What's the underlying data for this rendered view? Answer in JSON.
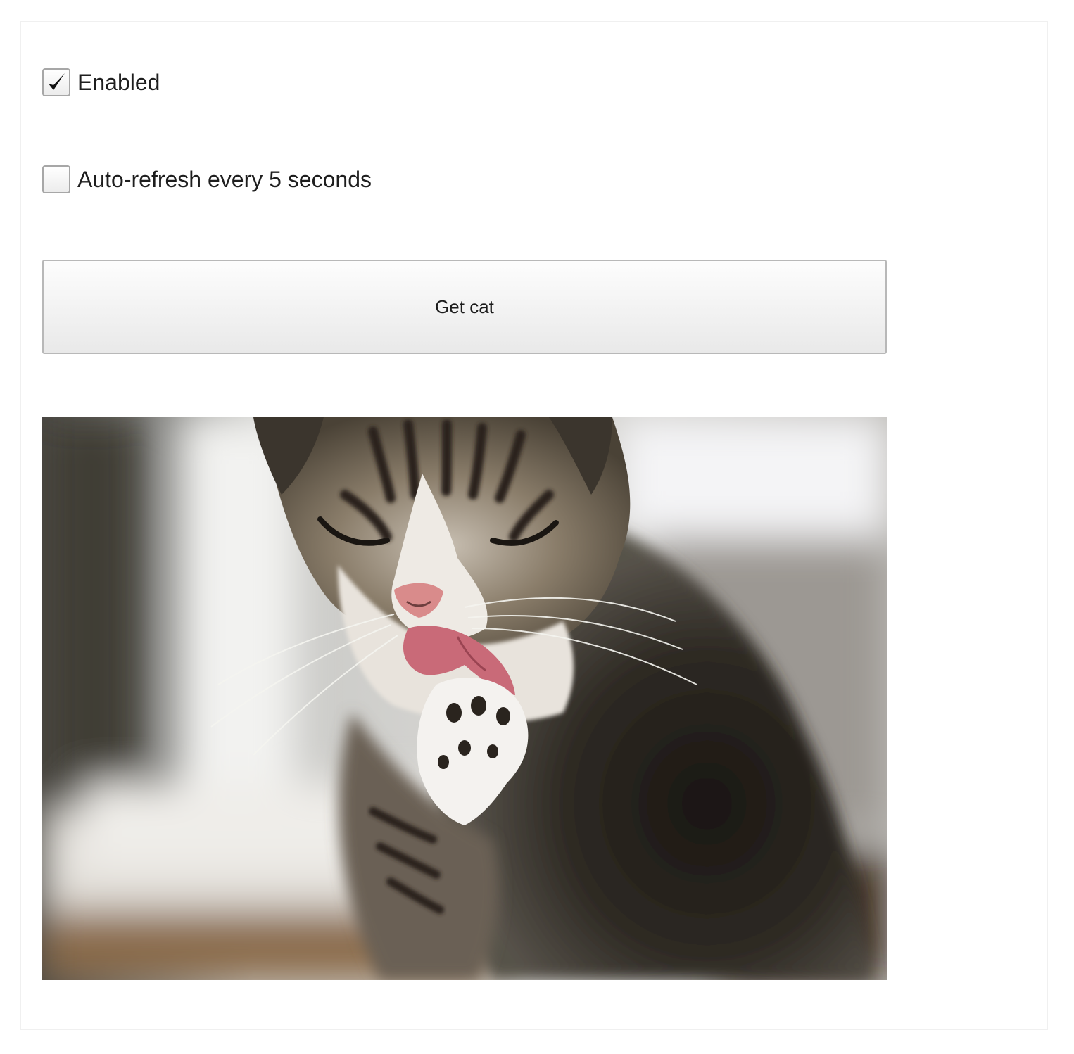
{
  "controls": {
    "enabled": {
      "label": "Enabled",
      "checked": true
    },
    "auto_refresh": {
      "label": "Auto-refresh every 5 seconds",
      "checked": false
    }
  },
  "button": {
    "label": "Get cat"
  },
  "image": {
    "subject": "cat",
    "alt": ""
  },
  "icons": {
    "checkmark": "checkmark-icon"
  }
}
